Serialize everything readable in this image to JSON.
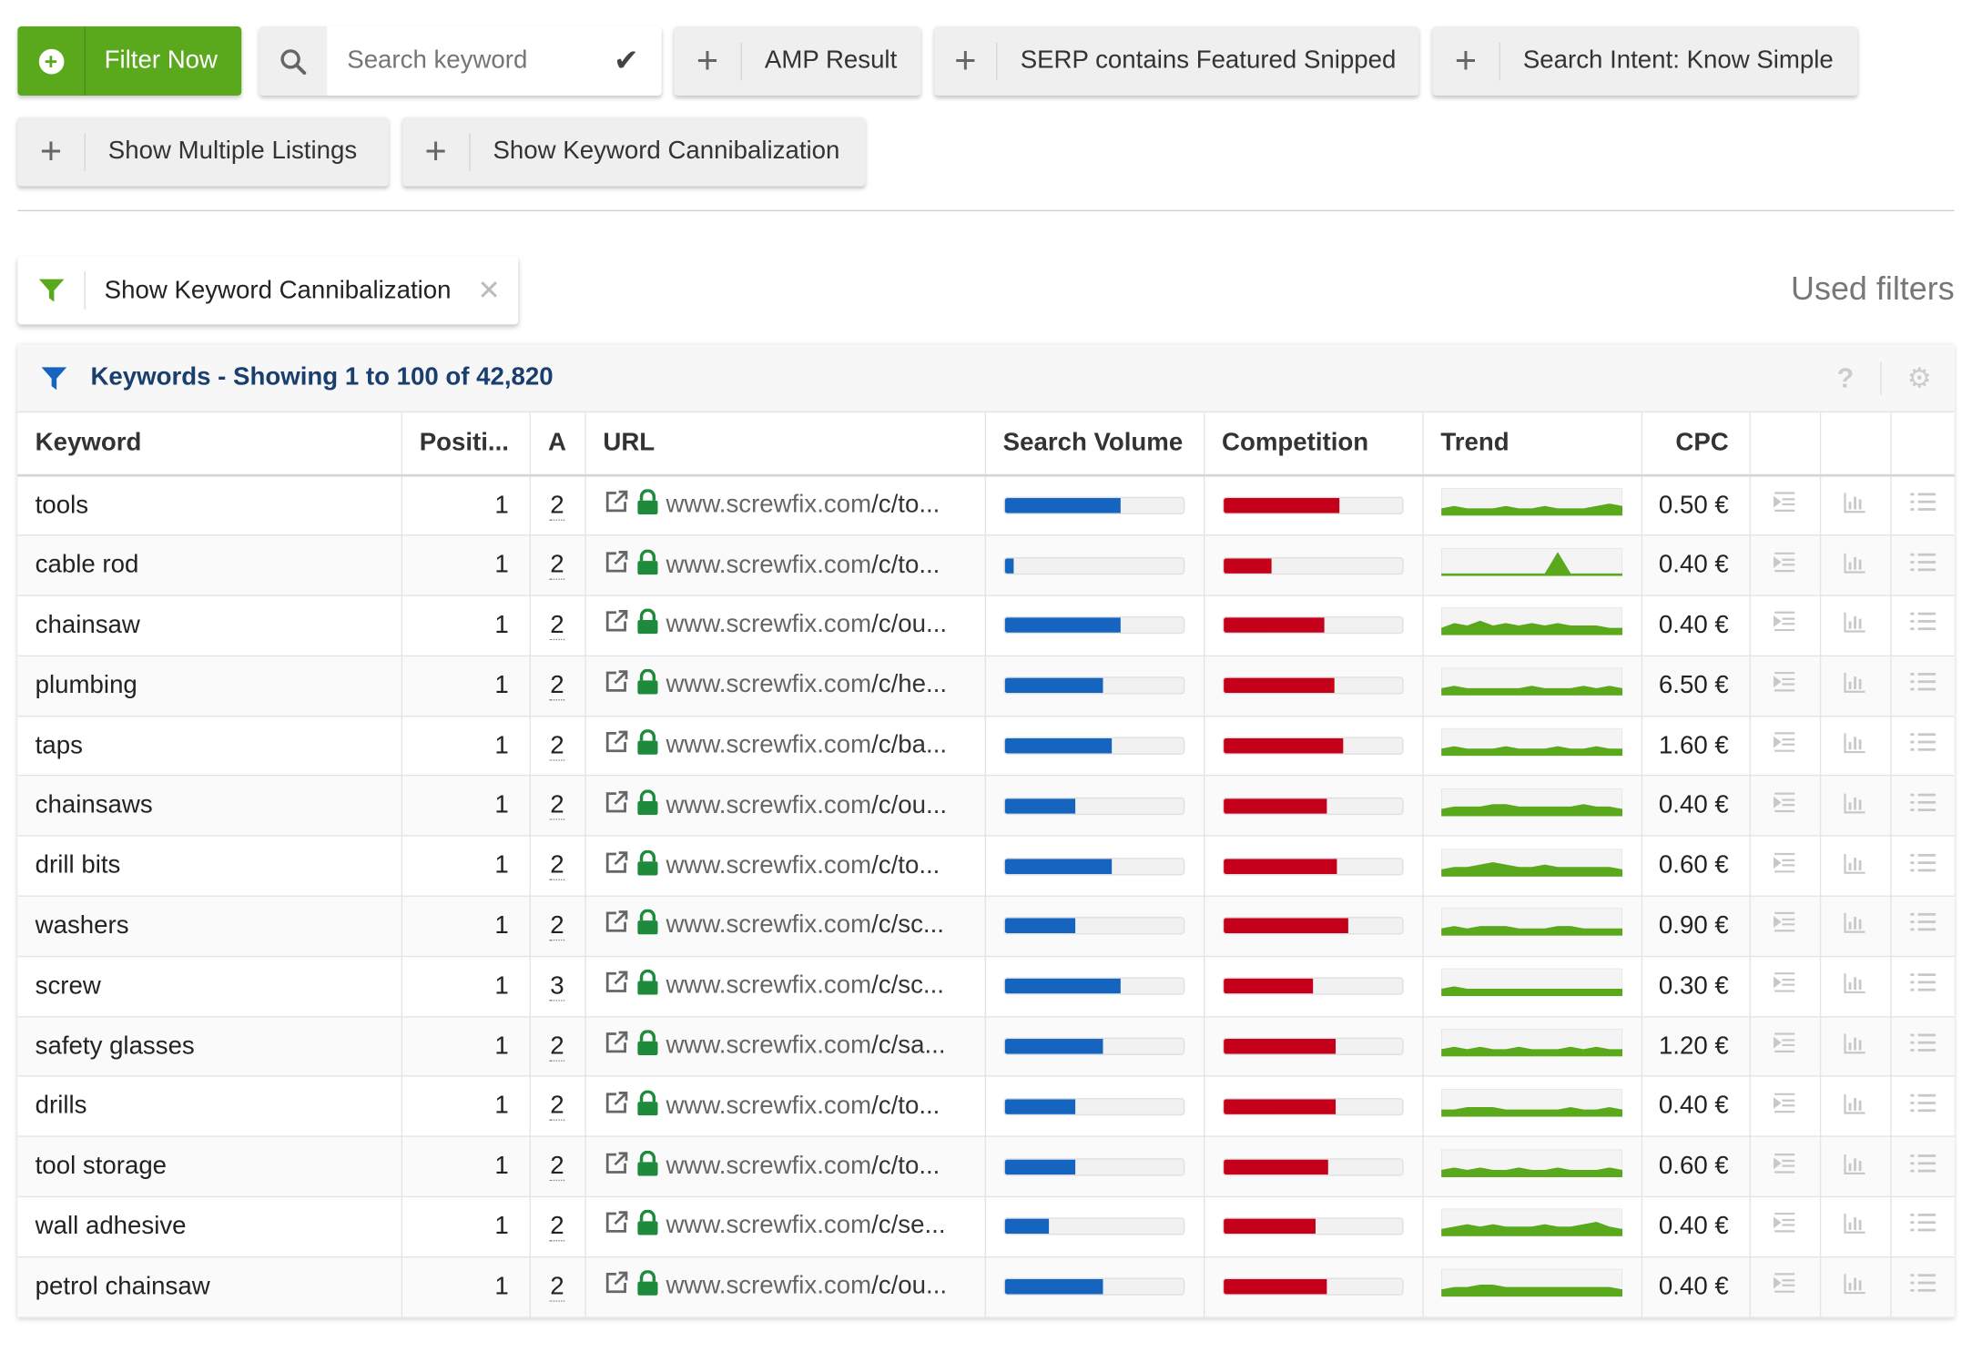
{
  "toolbar": {
    "filter_now_label": "Filter Now",
    "search_placeholder": "Search keyword",
    "buttons": [
      "AMP Result",
      "SERP contains Featured Snipped",
      "Search Intent: Know Simple",
      "Show Multiple Listings",
      "Show Keyword Cannibalization"
    ]
  },
  "used_filters": {
    "title": "Used filters",
    "chips": [
      "Show Keyword Cannibalization"
    ]
  },
  "panel": {
    "title": "Keywords - Showing 1 to 100 of 42,820",
    "help_label": "?"
  },
  "columns": [
    "Keyword",
    "Positi...",
    "A",
    "URL",
    "Search Volume",
    "Competition",
    "Trend",
    "CPC"
  ],
  "colors": {
    "accent_green": "#5aa91d",
    "volume_blue": "#1565c0",
    "competition_red": "#c4001b",
    "trend_green": "#5aa91d",
    "title_blue": "#1a3e6e"
  },
  "rows": [
    {
      "keyword": "tools",
      "position": "1",
      "a": "2",
      "url_domain": "www.screwfix.com",
      "url_path": "/c/to...",
      "volume": 0.65,
      "competition": 0.65,
      "trend": [
        2,
        3,
        2,
        2,
        2,
        3,
        2,
        2,
        3,
        2,
        2,
        2,
        3,
        4,
        3
      ],
      "cpc": "0.50 €"
    },
    {
      "keyword": "cable rod",
      "position": "1",
      "a": "2",
      "url_domain": "www.screwfix.com",
      "url_path": "/c/to...",
      "volume": 0.05,
      "competition": 0.27,
      "trend": [
        0,
        0,
        0,
        0,
        0,
        0,
        0,
        0,
        0,
        9,
        0,
        0,
        0,
        0,
        0
      ],
      "cpc": "0.40 €"
    },
    {
      "keyword": "chainsaw",
      "position": "1",
      "a": "2",
      "url_domain": "www.screwfix.com",
      "url_path": "/c/ou...",
      "volume": 0.65,
      "competition": 0.57,
      "trend": [
        2,
        4,
        3,
        5,
        3,
        4,
        3,
        4,
        3,
        4,
        3,
        3,
        3,
        2,
        2
      ],
      "cpc": "0.40 €"
    },
    {
      "keyword": "plumbing",
      "position": "1",
      "a": "2",
      "url_domain": "www.screwfix.com",
      "url_path": "/c/he...",
      "volume": 0.55,
      "competition": 0.62,
      "trend": [
        2,
        3,
        2,
        2,
        2,
        2,
        2,
        3,
        2,
        2,
        2,
        3,
        2,
        3,
        2
      ],
      "cpc": "6.50 €"
    },
    {
      "keyword": "taps",
      "position": "1",
      "a": "2",
      "url_domain": "www.screwfix.com",
      "url_path": "/c/ba...",
      "volume": 0.6,
      "competition": 0.67,
      "trend": [
        2,
        3,
        2,
        2,
        2,
        3,
        2,
        2,
        2,
        3,
        2,
        2,
        3,
        2,
        2
      ],
      "cpc": "1.60 €"
    },
    {
      "keyword": "chainsaws",
      "position": "1",
      "a": "2",
      "url_domain": "www.screwfix.com",
      "url_path": "/c/ou...",
      "volume": 0.4,
      "competition": 0.58,
      "trend": [
        2,
        3,
        3,
        3,
        4,
        4,
        3,
        3,
        3,
        3,
        3,
        4,
        3,
        3,
        2
      ],
      "cpc": "0.40 €"
    },
    {
      "keyword": "drill bits",
      "position": "1",
      "a": "2",
      "url_domain": "www.screwfix.com",
      "url_path": "/c/to...",
      "volume": 0.6,
      "competition": 0.64,
      "trend": [
        2,
        3,
        3,
        4,
        5,
        4,
        3,
        3,
        4,
        3,
        3,
        3,
        3,
        3,
        2
      ],
      "cpc": "0.60 €"
    },
    {
      "keyword": "washers",
      "position": "1",
      "a": "2",
      "url_domain": "www.screwfix.com",
      "url_path": "/c/sc...",
      "volume": 0.4,
      "competition": 0.7,
      "trend": [
        2,
        3,
        2,
        3,
        3,
        3,
        2,
        2,
        2,
        3,
        3,
        2,
        2,
        2,
        2
      ],
      "cpc": "0.90 €"
    },
    {
      "keyword": "screw",
      "position": "1",
      "a": "3",
      "url_domain": "www.screwfix.com",
      "url_path": "/c/sc...",
      "volume": 0.65,
      "competition": 0.5,
      "trend": [
        2,
        3,
        2,
        2,
        2,
        2,
        2,
        2,
        2,
        2,
        2,
        2,
        2,
        2,
        2
      ],
      "cpc": "0.30 €"
    },
    {
      "keyword": "safety glasses",
      "position": "1",
      "a": "2",
      "url_domain": "www.screwfix.com",
      "url_path": "/c/sa...",
      "volume": 0.55,
      "competition": 0.63,
      "trend": [
        2,
        3,
        2,
        3,
        2,
        2,
        3,
        2,
        2,
        2,
        3,
        2,
        3,
        2,
        2
      ],
      "cpc": "1.20 €"
    },
    {
      "keyword": "drills",
      "position": "1",
      "a": "2",
      "url_domain": "www.screwfix.com",
      "url_path": "/c/to...",
      "volume": 0.4,
      "competition": 0.63,
      "trend": [
        2,
        2,
        3,
        3,
        3,
        2,
        2,
        2,
        2,
        2,
        3,
        2,
        2,
        3,
        2
      ],
      "cpc": "0.40 €"
    },
    {
      "keyword": "tool storage",
      "position": "1",
      "a": "2",
      "url_domain": "www.screwfix.com",
      "url_path": "/c/to...",
      "volume": 0.4,
      "competition": 0.59,
      "trend": [
        2,
        3,
        2,
        3,
        2,
        2,
        3,
        2,
        2,
        3,
        2,
        2,
        2,
        3,
        2
      ],
      "cpc": "0.60 €"
    },
    {
      "keyword": "wall adhesive",
      "position": "1",
      "a": "2",
      "url_domain": "www.screwfix.com",
      "url_path": "/c/se...",
      "volume": 0.25,
      "competition": 0.52,
      "trend": [
        2,
        3,
        4,
        3,
        4,
        3,
        3,
        3,
        4,
        3,
        3,
        4,
        5,
        3,
        2
      ],
      "cpc": "0.40 €"
    },
    {
      "keyword": "petrol chainsaw",
      "position": "1",
      "a": "2",
      "url_domain": "www.screwfix.com",
      "url_path": "/c/ou...",
      "volume": 0.55,
      "competition": 0.58,
      "trend": [
        2,
        3,
        3,
        4,
        4,
        3,
        3,
        3,
        3,
        3,
        3,
        3,
        3,
        3,
        2
      ],
      "cpc": "0.40 €"
    }
  ]
}
